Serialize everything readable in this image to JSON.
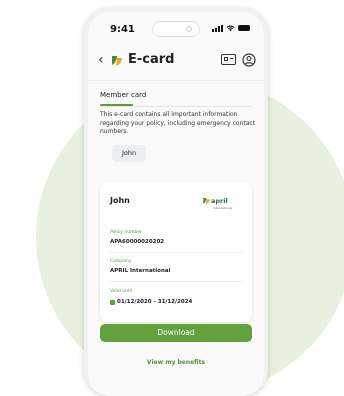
{
  "status_bar": {
    "time": "9:41"
  },
  "header": {
    "back_icon": "chevron-left-icon",
    "app_icon": "april-leaf-icon",
    "title": "E-card",
    "right_icons": [
      "id-card-icon",
      "profile-icon"
    ]
  },
  "tab": {
    "label": "Member card"
  },
  "description": "This e-card contains all important information regarding your policy, including emergency contact numbers.",
  "member_chip": "John",
  "card": {
    "holder_name": "John",
    "brand": {
      "name": "april",
      "tagline": "International"
    },
    "fields": [
      {
        "label": "Policy number",
        "value": "APA60000020202"
      },
      {
        "label": "Company",
        "value": "APRIL International"
      },
      {
        "label": "Valid until",
        "value": "01/12/2020 - 31/12/2024"
      }
    ]
  },
  "actions": {
    "download": "Download",
    "view_benefits": "View my benefits"
  },
  "colors": {
    "accent_green": "#63a13d",
    "brand_text": "#2d6e4e",
    "background_circle": "#e8f0df",
    "chip_bg": "#e9eef5"
  }
}
